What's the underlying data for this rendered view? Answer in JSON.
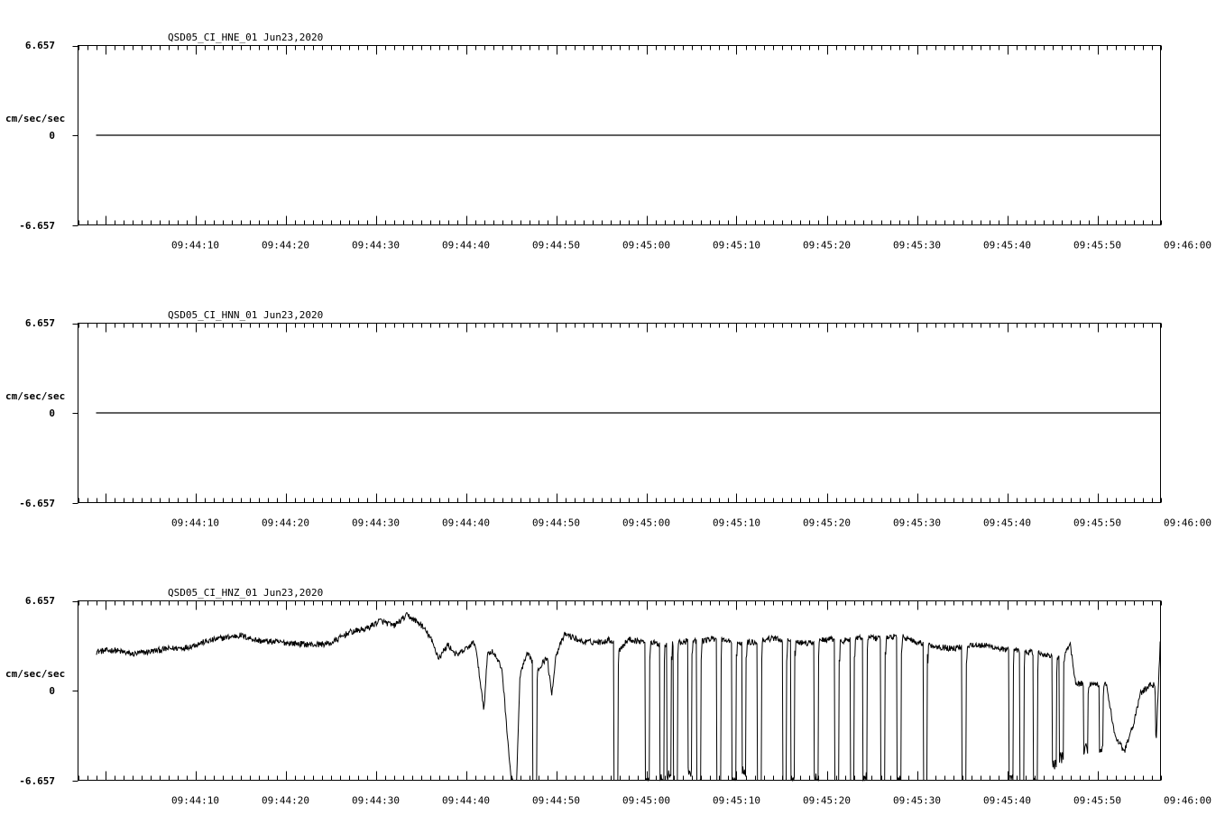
{
  "chart_data": [
    {
      "type": "line",
      "title": "QSD05_CI_HNE_01  Jun23,2020",
      "ylabel": "cm/sec/sec",
      "ylim": [
        -6.657,
        6.657
      ],
      "y_ticks": [
        "6.657",
        "0",
        "-6.657"
      ],
      "x_tick_labels": [
        "09:44:10",
        "09:44:20",
        "09:44:30",
        "09:44:40",
        "09:44:50",
        "09:45:00",
        "09:45:10",
        "09:45:20",
        "09:45:30",
        "09:45:40",
        "09:45:50",
        "09:46:00"
      ],
      "xlim_seconds": [
        -3.0,
        117.0
      ],
      "x_start_seconds": -1.0,
      "series": [
        {
          "values": "flat"
        }
      ]
    },
    {
      "type": "line",
      "title": "QSD05_CI_HNN_01  Jun23,2020",
      "ylabel": "cm/sec/sec",
      "ylim": [
        -6.657,
        6.657
      ],
      "y_ticks": [
        "6.657",
        "0",
        "-6.657"
      ],
      "x_tick_labels": [
        "09:44:10",
        "09:44:20",
        "09:44:30",
        "09:44:40",
        "09:44:50",
        "09:45:00",
        "09:45:10",
        "09:45:20",
        "09:45:30",
        "09:45:40",
        "09:45:50",
        "09:46:00"
      ],
      "xlim_seconds": [
        -3.0,
        117.0
      ],
      "x_start_seconds": -1.0,
      "series": [
        {
          "values": "flat"
        }
      ]
    },
    {
      "type": "line",
      "title": "QSD05_CI_HNZ_01  Jun23,2020",
      "ylabel": "cm/sec/sec",
      "ylim": [
        -6.657,
        6.657
      ],
      "y_ticks": [
        "6.657",
        "0",
        "-6.657"
      ],
      "x_tick_labels": [
        "09:44:10",
        "09:44:20",
        "09:44:30",
        "09:44:40",
        "09:44:50",
        "09:45:00",
        "09:45:10",
        "09:45:20",
        "09:45:30",
        "09:45:40",
        "09:45:50",
        "09:46:00"
      ],
      "xlim_seconds": [
        -3.0,
        117.0
      ],
      "x_start_seconds": -1.0,
      "series": [
        {
          "points": [
            [
              -1.0,
              2.9
            ],
            [
              1.0,
              3.0
            ],
            [
              3.0,
              2.7
            ],
            [
              5.0,
              2.9
            ],
            [
              7.0,
              3.1
            ],
            [
              9.0,
              3.2
            ],
            [
              11.0,
              3.6
            ],
            [
              13.0,
              3.9
            ],
            [
              15.0,
              4.1
            ],
            [
              17.0,
              3.7
            ],
            [
              19.0,
              3.6
            ],
            [
              21.0,
              3.5
            ],
            [
              23.0,
              3.4
            ],
            [
              25.0,
              3.5
            ],
            [
              27.0,
              4.3
            ],
            [
              29.0,
              4.6
            ],
            [
              30.5,
              5.2
            ],
            [
              32.0,
              4.8
            ],
            [
              33.5,
              5.6
            ],
            [
              35.0,
              4.9
            ],
            [
              36.0,
              4.0
            ],
            [
              37.0,
              2.4
            ],
            [
              38.0,
              3.4
            ],
            [
              39.0,
              2.6
            ],
            [
              40.0,
              3.1
            ],
            [
              41.0,
              3.6
            ],
            [
              42.0,
              -1.4
            ],
            [
              42.4,
              2.8
            ],
            [
              43.0,
              2.9
            ],
            [
              44.0,
              1.6
            ],
            [
              45.0,
              -6.6
            ],
            [
              45.6,
              -7.2
            ],
            [
              46.0,
              1.2
            ],
            [
              46.8,
              2.7
            ],
            [
              48.0,
              1.6
            ],
            [
              49.0,
              2.5
            ],
            [
              49.5,
              -0.3
            ],
            [
              50.0,
              2.7
            ],
            [
              51.0,
              4.2
            ],
            [
              53.0,
              3.6
            ],
            [
              55.0,
              3.6
            ],
            [
              56.0,
              3.8
            ],
            [
              57.0,
              3.0
            ],
            [
              58.0,
              3.8
            ],
            [
              60.0,
              3.6
            ],
            [
              62.0,
              3.4
            ],
            [
              64.0,
              3.6
            ],
            [
              66.0,
              3.7
            ],
            [
              68.0,
              3.9
            ],
            [
              70.0,
              3.5
            ],
            [
              72.0,
              3.6
            ],
            [
              74.0,
              3.9
            ],
            [
              76.0,
              3.6
            ],
            [
              78.0,
              3.5
            ],
            [
              80.0,
              3.8
            ],
            [
              82.0,
              3.7
            ],
            [
              84.0,
              4.0
            ],
            [
              86.0,
              3.8
            ],
            [
              88.0,
              4.1
            ],
            [
              90.0,
              3.6
            ],
            [
              92.0,
              3.3
            ],
            [
              94.0,
              3.1
            ],
            [
              96.0,
              3.4
            ],
            [
              98.0,
              3.3
            ],
            [
              100.0,
              3.0
            ],
            [
              102.0,
              2.9
            ],
            [
              104.0,
              2.7
            ],
            [
              106.0,
              2.4
            ],
            [
              107.0,
              3.4
            ],
            [
              107.6,
              0.5
            ],
            [
              109.0,
              0.5
            ],
            [
              111.0,
              0.4
            ],
            [
              112.0,
              -3.5
            ],
            [
              113.0,
              -4.5
            ],
            [
              114.0,
              -2.5
            ],
            [
              114.8,
              -0.2
            ],
            [
              115.8,
              0.4
            ],
            [
              116.4,
              0.4
            ],
            [
              116.5,
              -4.0
            ],
            [
              117.0,
              4.2
            ]
          ],
          "dropouts": [
            [
              47.4,
              -7.2
            ],
            [
              56.4,
              -7.0
            ],
            [
              59.9,
              -6.6
            ],
            [
              61.5,
              -6.4
            ],
            [
              62.3,
              -6.2
            ],
            [
              63.0,
              -7.0
            ],
            [
              64.6,
              -6.0
            ],
            [
              65.6,
              -7.0
            ],
            [
              67.8,
              -7.4
            ],
            [
              69.5,
              -6.8
            ],
            [
              70.6,
              -6.0
            ],
            [
              72.3,
              -7.2
            ],
            [
              75.1,
              -6.9
            ],
            [
              76.0,
              -6.5
            ],
            [
              78.6,
              -6.6
            ],
            [
              80.9,
              -7.4
            ],
            [
              82.6,
              -7.1
            ],
            [
              84.0,
              -6.5
            ],
            [
              86.0,
              -7.0
            ],
            [
              87.8,
              -6.8
            ],
            [
              90.7,
              -7.5
            ],
            [
              95.0,
              -7.6
            ],
            [
              100.2,
              -6.7
            ],
            [
              101.4,
              -6.8
            ],
            [
              102.9,
              -6.9
            ],
            [
              105.0,
              -5.5
            ],
            [
              105.8,
              -5.0
            ],
            [
              108.5,
              -4.3
            ],
            [
              110.2,
              -4.2
            ]
          ]
        }
      ]
    }
  ]
}
